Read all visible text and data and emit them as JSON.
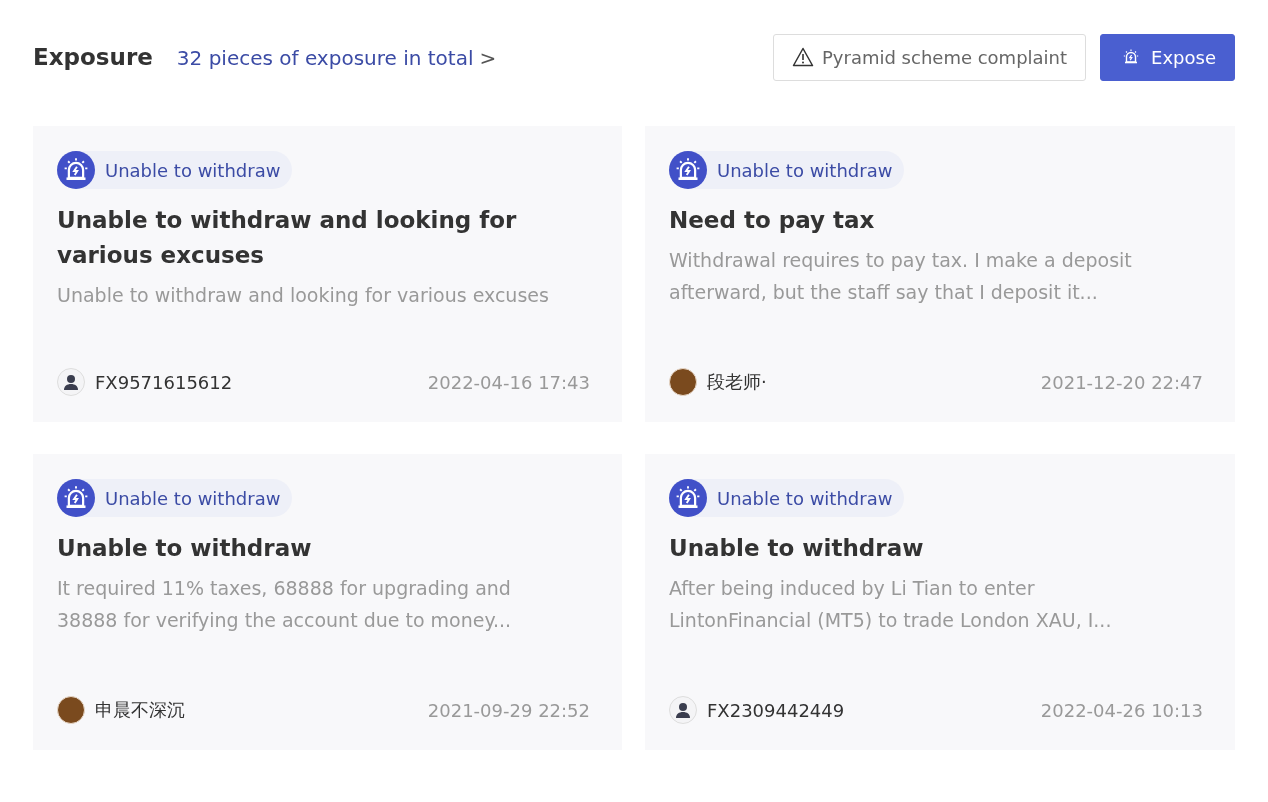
{
  "header": {
    "title": "Exposure",
    "total_link": "32 pieces of exposure in total",
    "link_arrow": ">"
  },
  "buttons": [
    {
      "kind": "outline",
      "label": "Pyramid scheme complaint"
    },
    {
      "kind": "primary",
      "label": "Expose"
    }
  ],
  "cards": [
    {
      "tag": "Unable to withdraw",
      "title": "Unable to withdraw and looking for various excuses",
      "description": "Unable to withdraw and looking for various excuses",
      "author": {
        "name": "FX9571615612",
        "kind": "default"
      },
      "date": "2022-04-16 17:43"
    },
    {
      "tag": "Unable to withdraw",
      "title": "Need to pay tax",
      "description": "Withdrawal requires to pay tax. I make a deposit afterward, but the staff say that I deposit it...",
      "author": {
        "name": "段老师·",
        "kind": "photo"
      },
      "date": "2021-12-20 22:47"
    },
    {
      "tag": "Unable to withdraw",
      "title": "Unable to withdraw",
      "description": "It required 11% taxes, 68888 for upgrading and 38888 for verifying the account due to money...",
      "author": {
        "name": "申晨不深沉",
        "kind": "photo"
      },
      "date": "2021-09-29 22:52"
    },
    {
      "tag": "Unable to withdraw",
      "title": "Unable to withdraw",
      "description": "After being induced by Li Tian to enter LintonFinancial (MT5) to trade London XAU, I...",
      "author": {
        "name": "FX2309442449",
        "kind": "default"
      },
      "date": "2022-04-26 10:13"
    }
  ]
}
